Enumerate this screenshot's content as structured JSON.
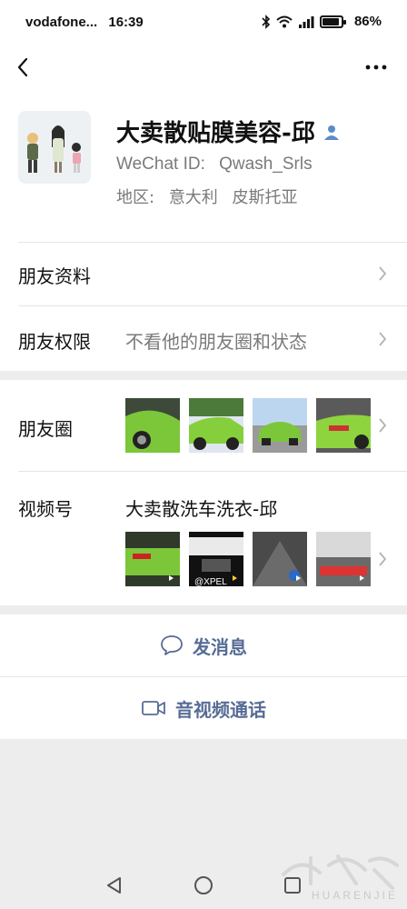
{
  "status_bar": {
    "carrier": "vodafone...",
    "time": "16:39",
    "battery": "86%",
    "icons": [
      "bluetooth-icon",
      "wifi-icon",
      "signal-icon",
      "battery-icon"
    ]
  },
  "nav": {
    "back_icon": "chevron-left-icon",
    "more_icon": "more-dots-icon"
  },
  "profile": {
    "name": "大卖散贴膜美容-邱",
    "gender_icon": "person-icon",
    "wechat_id_label": "WeChat ID:",
    "wechat_id": "Qwash_Srls",
    "region_label": "地区:",
    "region_country": "意大利",
    "region_city": "皮斯托亚"
  },
  "rows": {
    "friend_info": {
      "label": "朋友资料"
    },
    "permissions": {
      "label": "朋友权限",
      "value": "不看他的朋友圈和状态"
    },
    "moments": {
      "label": "朋友圈",
      "thumb_count": 4
    },
    "channels": {
      "label": "视频号",
      "value": "大卖散洗车洗衣-邱",
      "thumb_count": 4
    }
  },
  "actions": {
    "message": "发消息",
    "call": "音视频通话"
  },
  "watermark": {
    "text": "HUARENJIE"
  },
  "colors": {
    "link": "#576b95",
    "page_bg": "#ededed",
    "secondary_text": "#7a7a7a",
    "car_green": "#7cc63a"
  }
}
